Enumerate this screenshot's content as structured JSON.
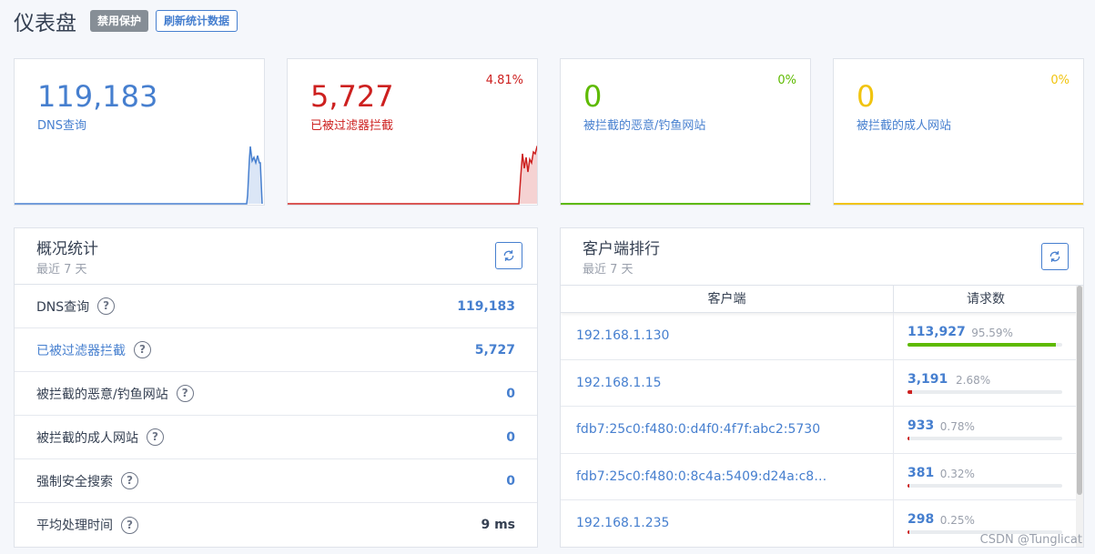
{
  "header": {
    "title": "仪表盘",
    "disable_protection": "禁用保护",
    "refresh_stats": "刷新统计数据"
  },
  "cards": [
    {
      "value": "119,183",
      "label": "DNS查询",
      "pct": "",
      "color": "#467fcf"
    },
    {
      "value": "5,727",
      "label": "已被过滤器拦截",
      "pct": "4.81%",
      "color": "#cd201f"
    },
    {
      "value": "0",
      "label": "被拦截的恶意/钓鱼网站",
      "pct": "0%",
      "color": "#5eba00"
    },
    {
      "value": "0",
      "label": "被拦截的成人网站",
      "pct": "0%",
      "color": "#f1c40f"
    }
  ],
  "overview": {
    "title": "概况统计",
    "subtitle": "最近 7 天",
    "rows": [
      {
        "label": "DNS查询",
        "value": "119,183"
      },
      {
        "label": "已被过滤器拦截",
        "value": "5,727"
      },
      {
        "label": "被拦截的恶意/钓鱼网站",
        "value": "0"
      },
      {
        "label": "被拦截的成人网站",
        "value": "0"
      },
      {
        "label": "强制安全搜索",
        "value": "0"
      },
      {
        "label": "平均处理时间",
        "value": "9 ms"
      }
    ]
  },
  "clients": {
    "title": "客户端排行",
    "subtitle": "最近 7 天",
    "col_client": "客户端",
    "col_requests": "请求数",
    "rows": [
      {
        "ip": "192.168.1.130",
        "count": "113,927",
        "pct": "95.59%",
        "bar": 0.9559,
        "bar_color": "#5eba00"
      },
      {
        "ip": "192.168.1.15",
        "count": "3,191",
        "pct": "2.68%",
        "bar": 0.0268,
        "bar_color": "#cd201f"
      },
      {
        "ip": "fdb7:25c0:f480:0:d4f0:4f7f:abc2:5730",
        "count": "933",
        "pct": "0.78%",
        "bar": 0.0078,
        "bar_color": "#cd201f"
      },
      {
        "ip": "fdb7:25c0:f480:0:8c4a:5409:d24a:c8…",
        "count": "381",
        "pct": "0.32%",
        "bar": 0.0032,
        "bar_color": "#cd201f"
      },
      {
        "ip": "192.168.1.235",
        "count": "298",
        "pct": "0.25%",
        "bar": 0.0025,
        "bar_color": "#cd201f"
      }
    ]
  },
  "watermark": "CSDN @Tunglicat"
}
